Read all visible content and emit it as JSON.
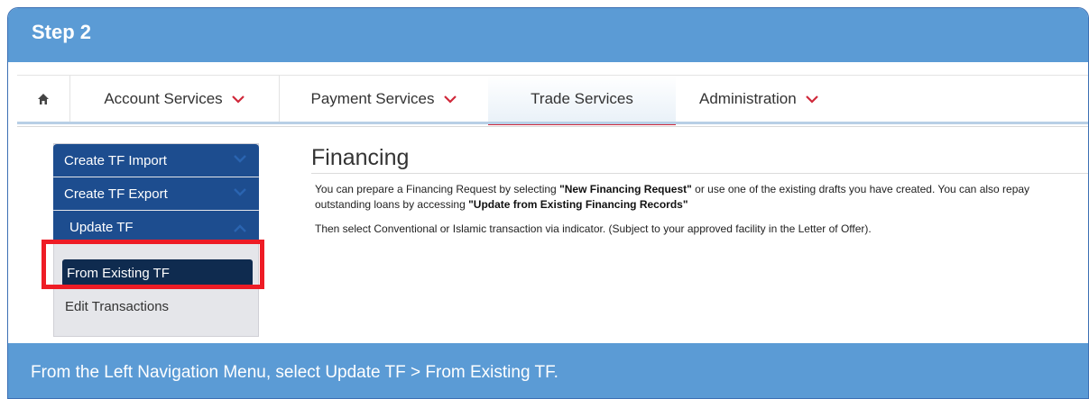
{
  "step": {
    "title": "Step 2"
  },
  "nav": {
    "items": [
      {
        "label": "Account Services"
      },
      {
        "label": "Payment Services"
      },
      {
        "label": "Trade Services"
      },
      {
        "label": "Administration"
      }
    ]
  },
  "sidebar": {
    "create_import": "Create TF Import",
    "create_export": "Create TF Export",
    "update_tf": "Update TF",
    "from_existing": "From Existing TF",
    "edit_transactions": "Edit Transactions"
  },
  "content": {
    "title": "Financing",
    "p1_a": "You can prepare a Financing Request by selecting ",
    "p1_b": "\"New Financing Request\"",
    "p1_c": " or use one of the existing drafts you have created. You can also repay outstanding loans by accessing ",
    "p1_d": "\"Update from Existing Financing Records\"",
    "p2": "Then select Conventional or Islamic transaction via indicator. (Subject to your approved facility in the Letter of Offer)."
  },
  "instruction": {
    "text": "From the Left Navigation Menu, select Update TF > From Existing TF."
  },
  "colors": {
    "header_blue": "#5b9bd5",
    "menu_blue": "#1d4d8f",
    "accent_red": "#d0283a",
    "highlight_red": "#ee1c25"
  }
}
